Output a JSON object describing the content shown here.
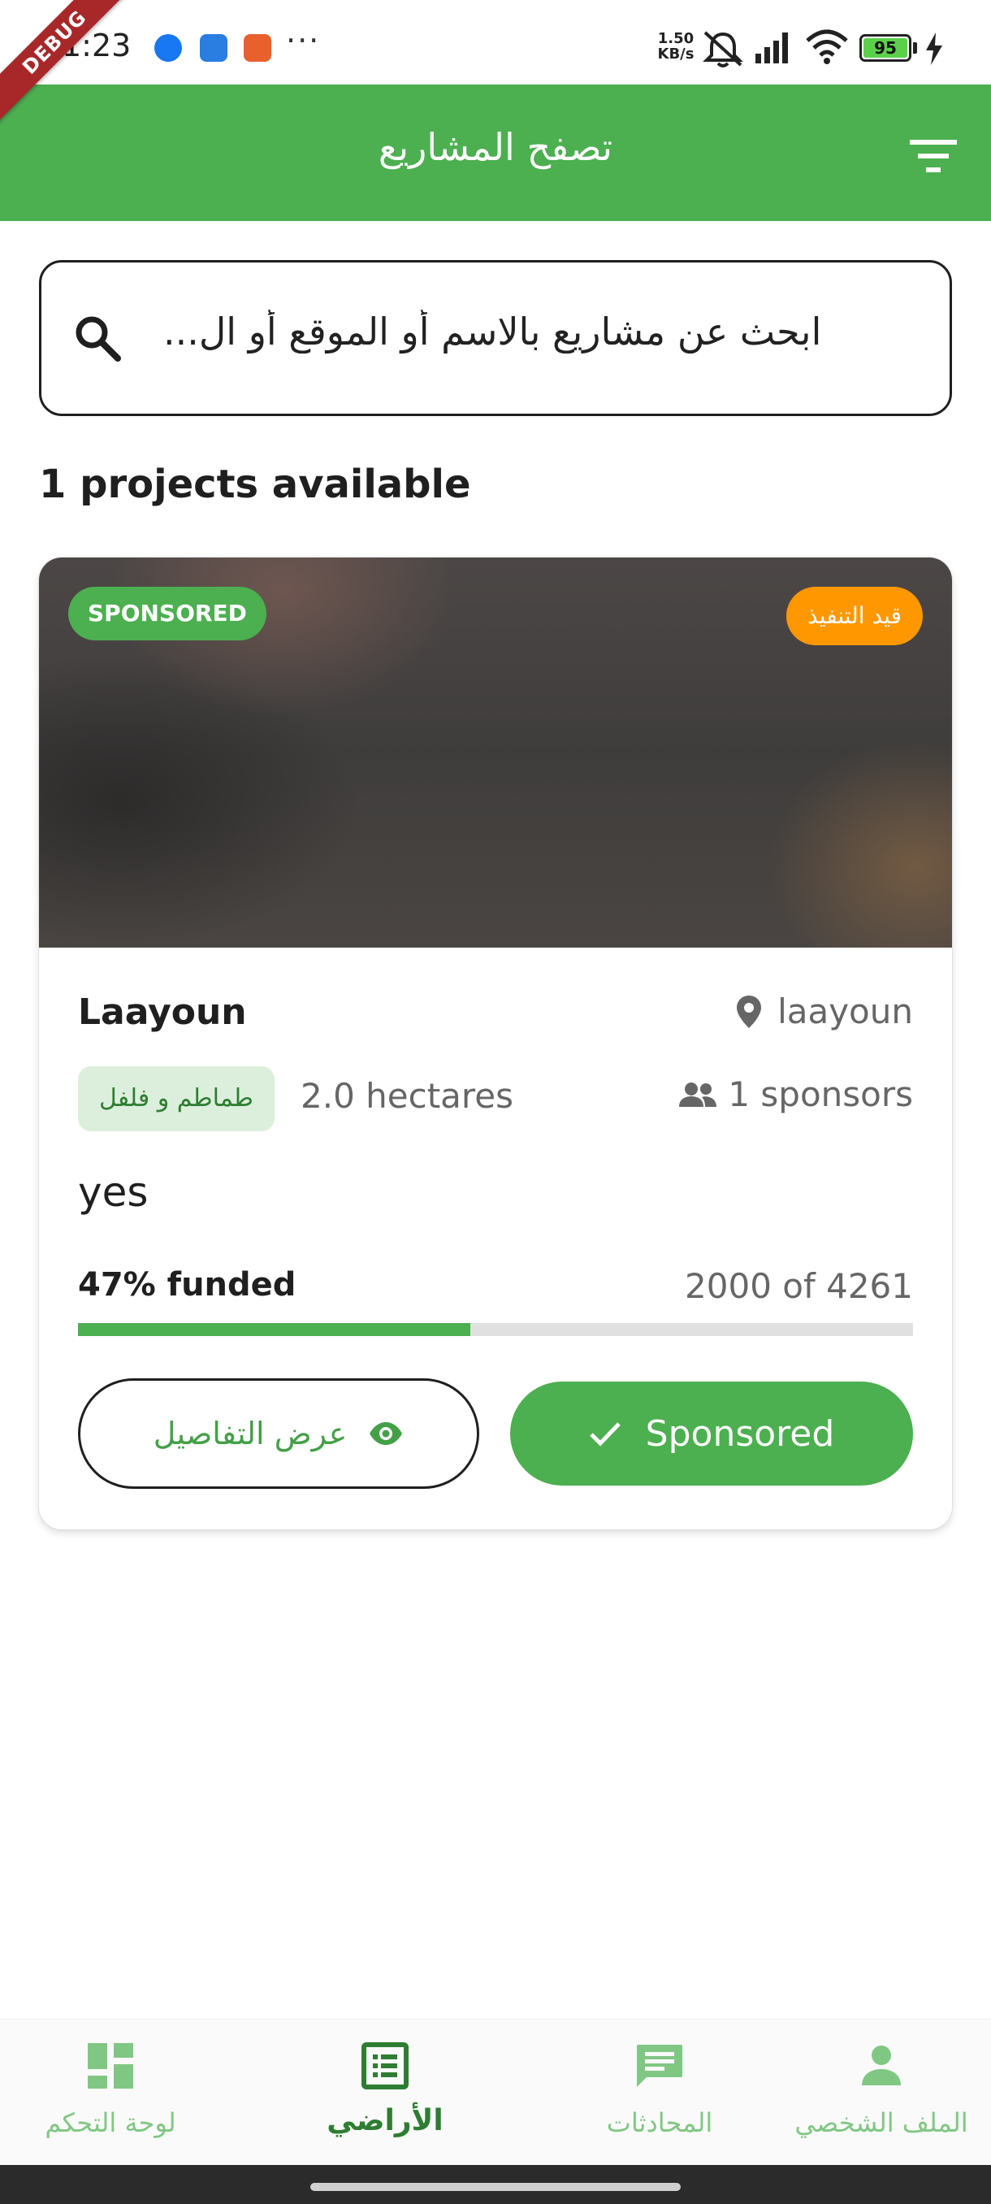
{
  "status_bar": {
    "time": "1:23",
    "more": "···",
    "net_speed_value": "1.50",
    "net_speed_unit": "KB/s",
    "battery": "95",
    "debug_label": "DEBUG"
  },
  "app_bar": {
    "title": "تصفح المشاريع"
  },
  "search": {
    "value": "ابحث عن مشاريع بالاسم أو الموقع أو ال..."
  },
  "results": {
    "count_label": "1 projects available"
  },
  "project": {
    "sponsored_badge": "SPONSORED",
    "status_badge": "قيد التنفيذ",
    "name": "Laayoun",
    "location": "laayoun",
    "crop": "طماطم و فلفل",
    "area": "2.0 hectares",
    "sponsors": "1 sponsors",
    "description": "yes",
    "funded_label": "47% funded",
    "funded_amount": "2000 of 4261",
    "funded_fraction": 0.47,
    "details_button": "عرض التفاصيل",
    "sponsored_button": "Sponsored"
  },
  "bottom_nav": {
    "items": [
      {
        "label": "لوحة التحكم",
        "icon": "dashboard-icon"
      },
      {
        "label": "الأراضي",
        "icon": "list-alt-icon",
        "active": true
      },
      {
        "label": "المحادثات",
        "icon": "chat-icon"
      },
      {
        "label": "الملف الشخصي",
        "icon": "person-icon"
      }
    ]
  },
  "colors": {
    "primary": "#4caf50",
    "primary_dark": "#2e7d32",
    "accent_orange": "#ff9800",
    "chip_bg": "#dcefdc",
    "nav_inactive": "#81c784"
  }
}
